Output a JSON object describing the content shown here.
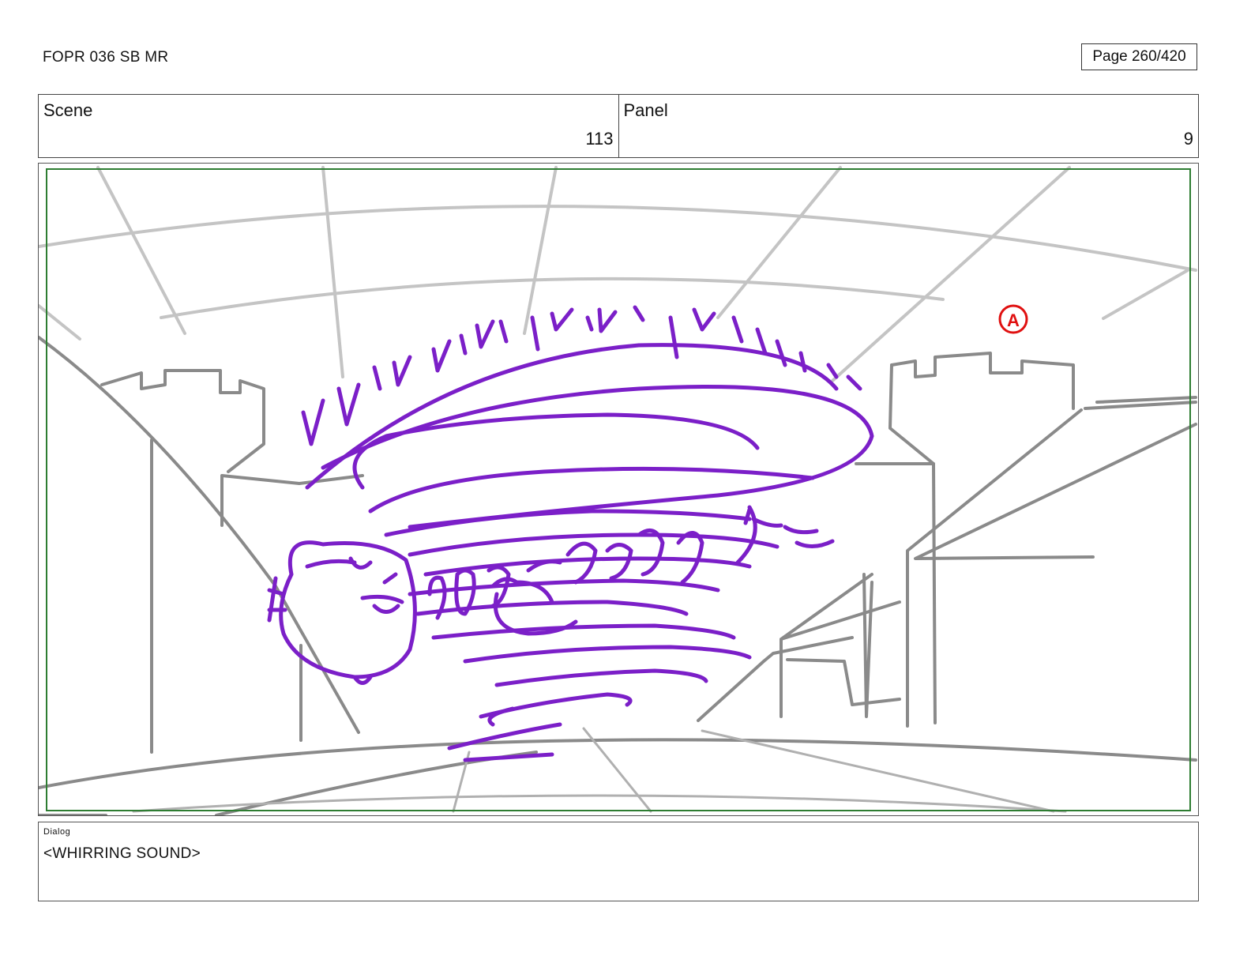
{
  "header": {
    "doc_title": "FOPR 036 SB MR",
    "page_indicator": "Page 260/420"
  },
  "info": {
    "scene_label": "Scene",
    "scene_value": "113",
    "panel_label": "Panel",
    "panel_value": "9"
  },
  "panel_art": {
    "annotation_mark": "A",
    "colors": {
      "frame_guide": "#2e7d32",
      "sketch": "#7b1fc8",
      "background_lines": "#8a8a8a",
      "annotation": "#e01010"
    }
  },
  "dialog": {
    "label": "Dialog",
    "text": "<WHIRRING SOUND>"
  }
}
